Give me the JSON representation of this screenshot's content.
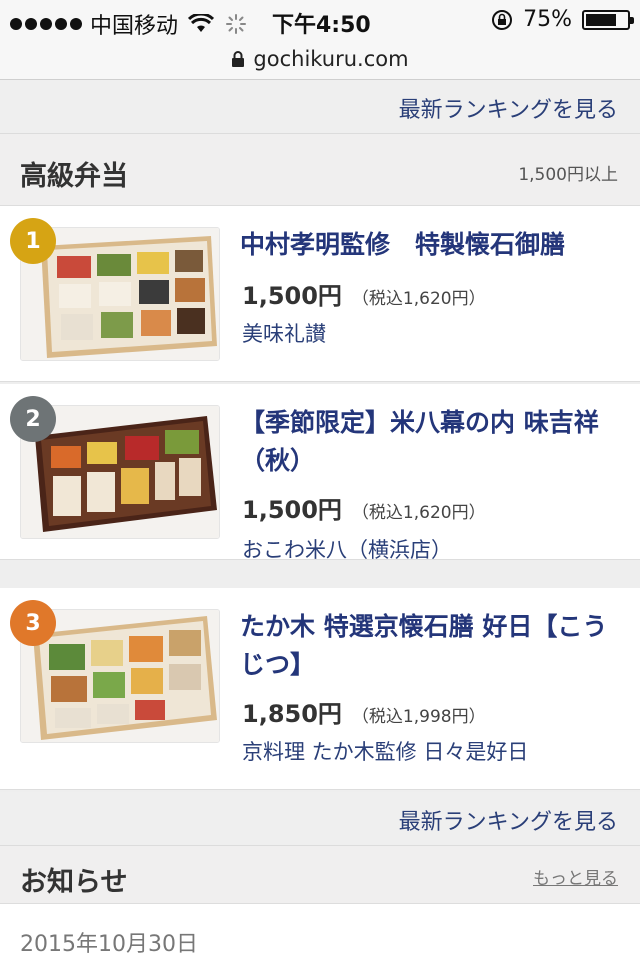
{
  "status_bar": {
    "carrier": "中国移动",
    "time": "下午4:50",
    "battery": "75%",
    "battery_level": 0.75,
    "icons": [
      "signal-dots-icon",
      "wifi-icon",
      "loading-spinner-icon",
      "rotation-lock-icon",
      "battery-icon"
    ]
  },
  "url_bar": {
    "url": "gochikuru.com",
    "icon": "padlock-icon"
  },
  "ranking_link": "最新ランキングを見る",
  "category": {
    "title": "高級弁当",
    "price_note": "1,500円以上"
  },
  "items": [
    {
      "rank": "1",
      "badge_color": "#d6a414",
      "title": "中村孝明監修　特製懐石御膳",
      "price": "1,500円",
      "tax_price": "（税込1,620円）",
      "shop": "美味礼讃"
    },
    {
      "rank": "2",
      "badge_color": "#6e7476",
      "title": "【季節限定】米八幕の内 味吉祥（秋）",
      "price": "1,500円",
      "tax_price": "（税込1,620円）",
      "shop": "おこわ米八（横浜店）"
    },
    {
      "rank": "3",
      "badge_color": "#e0782a",
      "title": "たか木 特選京懐石膳 好日【こうじつ】",
      "price": "1,850円",
      "tax_price": "（税込1,998円）",
      "shop": "京料理 たか木監修 日々是好日"
    }
  ],
  "notice": {
    "title": "お知らせ",
    "more": "もっと見る",
    "first_date": "2015年10月30日"
  }
}
